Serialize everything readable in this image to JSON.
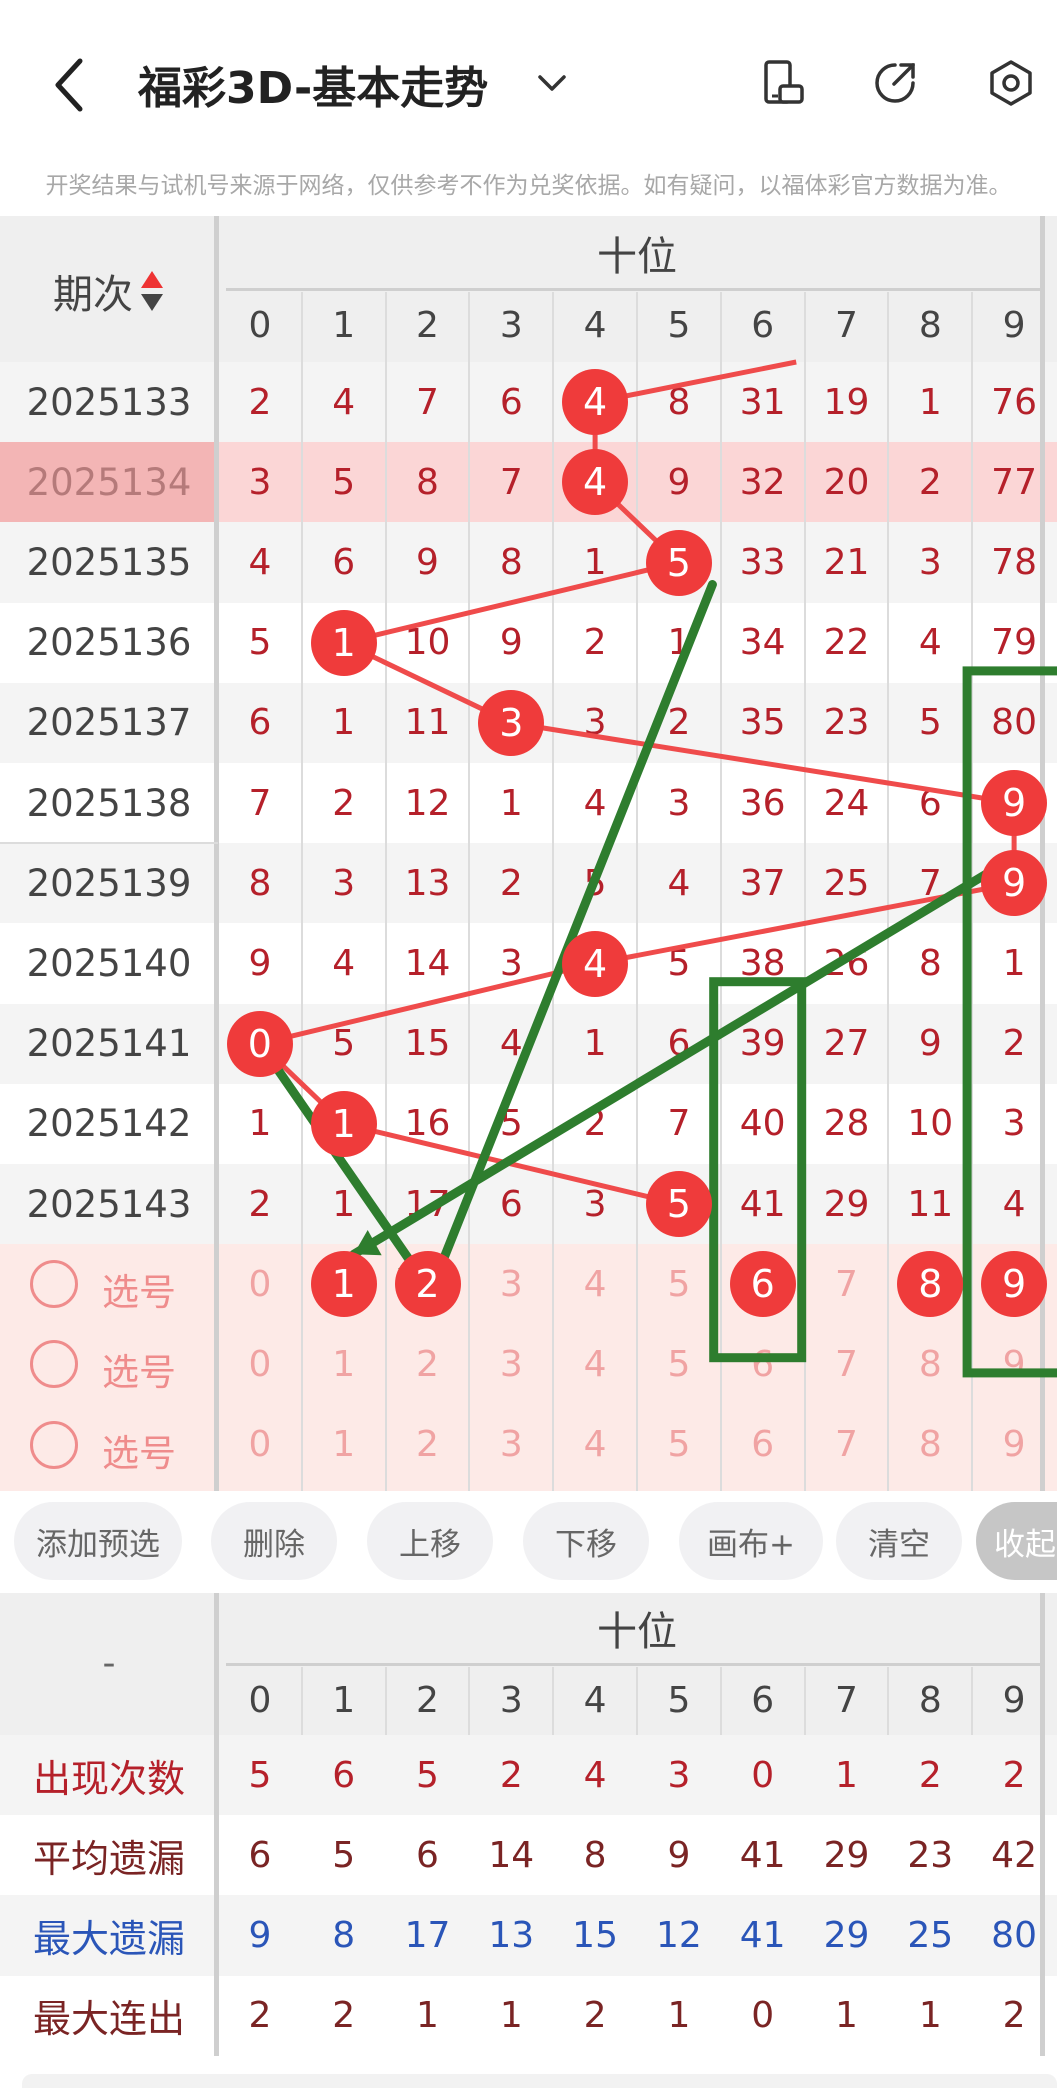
{
  "header": {
    "title": "福彩3D-基本走势",
    "notice": "开奖结果与试机号来源于网络，仅供参考不作为兑奖依据。如有疑问，以福体彩官方数据为准。"
  },
  "chart": {
    "corner_label": "期次",
    "group_label": "十位",
    "digits": [
      "0",
      "1",
      "2",
      "3",
      "4",
      "5",
      "6",
      "7",
      "8",
      "9"
    ],
    "rows": [
      {
        "issue": "2025133",
        "hit": 4,
        "cells": [
          "2",
          "4",
          "7",
          "6",
          "4",
          "8",
          "31",
          "19",
          "1",
          "76"
        ]
      },
      {
        "issue": "2025134",
        "hit": 4,
        "cells": [
          "3",
          "5",
          "8",
          "7",
          "4",
          "9",
          "32",
          "20",
          "2",
          "77"
        ]
      },
      {
        "issue": "2025135",
        "hit": 5,
        "cells": [
          "4",
          "6",
          "9",
          "8",
          "1",
          "5",
          "33",
          "21",
          "3",
          "78"
        ]
      },
      {
        "issue": "2025136",
        "hit": 1,
        "cells": [
          "5",
          "1",
          "10",
          "9",
          "2",
          "1",
          "34",
          "22",
          "4",
          "79"
        ]
      },
      {
        "issue": "2025137",
        "hit": 3,
        "cells": [
          "6",
          "1",
          "11",
          "3",
          "3",
          "2",
          "35",
          "23",
          "5",
          "80"
        ]
      },
      {
        "issue": "2025138",
        "hit": 9,
        "cells": [
          "7",
          "2",
          "12",
          "1",
          "4",
          "3",
          "36",
          "24",
          "6",
          "9"
        ]
      },
      {
        "issue": "2025139",
        "hit": 9,
        "cells": [
          "8",
          "3",
          "13",
          "2",
          "5",
          "4",
          "37",
          "25",
          "7",
          "9"
        ]
      },
      {
        "issue": "2025140",
        "hit": 4,
        "cells": [
          "9",
          "4",
          "14",
          "3",
          "4",
          "5",
          "38",
          "26",
          "8",
          "1"
        ]
      },
      {
        "issue": "2025141",
        "hit": 0,
        "cells": [
          "0",
          "5",
          "15",
          "4",
          "1",
          "6",
          "39",
          "27",
          "9",
          "2"
        ]
      },
      {
        "issue": "2025142",
        "hit": 1,
        "cells": [
          "1",
          "1",
          "16",
          "5",
          "2",
          "7",
          "40",
          "28",
          "10",
          "3"
        ]
      },
      {
        "issue": "2025143",
        "hit": 5,
        "cells": [
          "2",
          "1",
          "17",
          "6",
          "3",
          "5",
          "41",
          "29",
          "11",
          "4"
        ]
      }
    ],
    "select_rows": [
      {
        "label": "选号",
        "selected": [
          1,
          2,
          6,
          8,
          9
        ]
      },
      {
        "label": "选号",
        "selected": []
      },
      {
        "label": "选号",
        "selected": []
      }
    ]
  },
  "buttons": [
    "添加预选",
    "删除",
    "上移",
    "下移",
    "画布+",
    "清空",
    "收起"
  ],
  "stats": {
    "corner_label": "-",
    "group_label": "十位",
    "rows": [
      {
        "label": "出现次数",
        "color": "#b5202a",
        "values": [
          "5",
          "6",
          "5",
          "2",
          "4",
          "3",
          "0",
          "1",
          "2",
          "2"
        ]
      },
      {
        "label": "平均遗漏",
        "color": "#7a2424",
        "values": [
          "6",
          "5",
          "6",
          "14",
          "8",
          "9",
          "41",
          "29",
          "23",
          "42"
        ]
      },
      {
        "label": "最大遗漏",
        "color": "#2a55b8",
        "values": [
          "9",
          "8",
          "17",
          "13",
          "15",
          "12",
          "41",
          "29",
          "25",
          "80"
        ]
      },
      {
        "label": "最大连出",
        "color": "#7a2424",
        "values": [
          "2",
          "2",
          "1",
          "1",
          "2",
          "1",
          "0",
          "1",
          "1",
          "2"
        ]
      }
    ]
  },
  "colors": {
    "ball": "#ef3b3b",
    "annotation": "#2e7d2e",
    "highlight_row": "#fbd6d6"
  }
}
